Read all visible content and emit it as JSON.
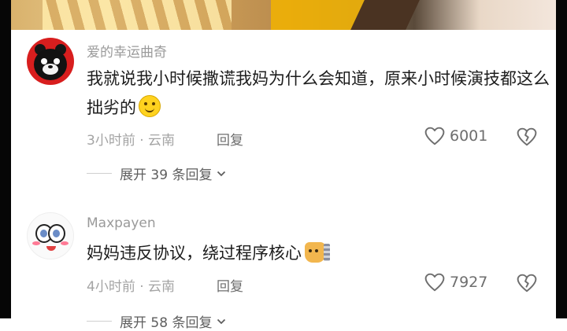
{
  "comments": [
    {
      "username": "爱的幸运曲奇",
      "text": "我就说我小时候撒谎我妈为什么会知道，原来小时候演技都这么拙劣的",
      "emoji": "smiling-face-emoji",
      "time_location": "3小时前 · 云南",
      "reply_label": "回复",
      "likes": "6001",
      "expand_label": "展开 39 条回复"
    },
    {
      "username": "Maxpayen",
      "text": "妈妈违反协议，绕过程序核心",
      "emoji": "cat-emoji",
      "time_location": "4小时前 · 云南",
      "reply_label": "回复",
      "likes": "7927",
      "expand_label": "展开 58 条回复"
    }
  ],
  "icons": {
    "like": "heart-outline-icon",
    "dislike": "broken-heart-icon",
    "expand": "chevron-down-icon"
  },
  "colors": {
    "username": "#9a9a9a",
    "text": "#1d1d1d",
    "meta": "#a4a4a4",
    "avatar_bear": "#d81e1e"
  }
}
